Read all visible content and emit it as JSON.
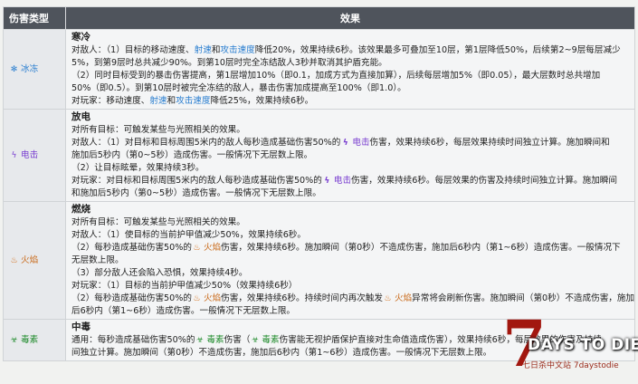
{
  "header": {
    "type_label": "伤害类型",
    "effect_label": "效果"
  },
  "rows": [
    {
      "icon_color": "#2b7fd0",
      "type_name": "冰冻",
      "title": "寒冷",
      "lines": [
        [
          "对敌人：（1）目标的移动速度、",
          {
            "link": "射速"
          },
          "和",
          {
            "link": "攻击速度"
          },
          "降低20%，效果持续6秒。该效果最多可叠加至10层，第1层降低50%，后续第2~9层每层减少"
        ],
        [
          "5%，到第9层时总共减少90%。到第10层时完全冻结敌人3秒并取消其护盾充能。"
        ],
        [
          "（2）同时目标受到的暴击伤害提高，第1层增加10%（即0.1，加成方式为直接加算），后续每层增加5%（即0.05），最大层数时总共增加"
        ],
        [
          "50%（即0.5）。到第10层时被完全冻结的敌人，暴击伤害加成提高至100%（即1.0）。"
        ],
        [
          "对玩家：移动速度、",
          {
            "link": "射速"
          },
          "和",
          {
            "link": "攻击速度"
          },
          "降低25%，效果持续6秒。"
        ]
      ]
    },
    {
      "icon_color": "#7a3fd0",
      "type_name": "电击",
      "title": "放电",
      "lines": [
        [
          "对所有目标：可触发某些与光照相关的效果。"
        ],
        [
          "对敌人：（1）对目标和目标周围5米内的敌人每秒造成基础伤害50%的",
          {
            "shock": "电击"
          },
          "伤害，效果持续6秒，每层效果持续时间独立计算。施加瞬间和"
        ],
        [
          "施加后5秒内（第0~5秒）造成伤害。一般情况下无层数上限。"
        ],
        [
          "（2）让目标眩晕，效果持续3秒。"
        ],
        [
          "对玩家：对目标和目标周围5米内的敌人每秒造成基础伤害50%的",
          {
            "shock": "电击"
          },
          "伤害，效果持续6秒。每层效果的伤害及持续时间独立计算。施加瞬间"
        ],
        [
          "和施加后5秒内（第0~5秒）造成伤害。一般情况下无层数上限。"
        ]
      ]
    },
    {
      "icon_color": "#d46a12",
      "type_name": "火焰",
      "title": "燃烧",
      "lines": [
        [
          "对所有目标：可触发某些与光照相关的效果。"
        ],
        [
          "对敌人：（1）使目标的当前护甲值减少50%，效果持续6秒。"
        ],
        [
          "（2）每秒造成基础伤害50%的",
          {
            "fire": "火焰"
          },
          "伤害，效果持续6秒。施加瞬间（第0秒）不造成伤害，施加后6秒内（第1~6秒）造成伤害。一般情况下"
        ],
        [
          "无层数上限。"
        ],
        [
          "（3）部分敌人还会陷入恐惧，效果持续4秒。"
        ],
        [
          "对玩家：（1）目标的当前护甲值减少50%（效果持续6秒）"
        ],
        [
          "（2）每秒造成基础伤害50%的",
          {
            "fire": "火焰"
          },
          "伤害，效果持续6秒。持续时间内再次触发",
          {
            "fire": "火焰"
          },
          "异常将会刷新伤害。施加瞬间（第0秒）不造成伤害，施加"
        ],
        [
          "后6秒内（第1~6秒）造成伤害。一般情况下无层数上限。"
        ]
      ]
    },
    {
      "icon_color": "#1e8a2a",
      "type_name": "毒素",
      "title": "中毒",
      "lines": [
        [
          "通用：每秒造成基础伤害50%的",
          {
            "poison": "毒素"
          },
          "伤害（",
          {
            "poison": "毒素"
          },
          "伤害能无视护盾保护直接对生命值造成伤害），效果持续6秒，每层效果的伤害及持续"
        ],
        [
          "间独立计算。施加瞬间（第0秒）不造成伤害，施加后6秒内（第1~6秒）造成伤害。一般情况下无层数上限。"
        ]
      ]
    }
  ],
  "logo": {
    "seven": "7",
    "days": "DAYS TO DIE",
    "sub": "七日杀中文站 7daystodie"
  }
}
